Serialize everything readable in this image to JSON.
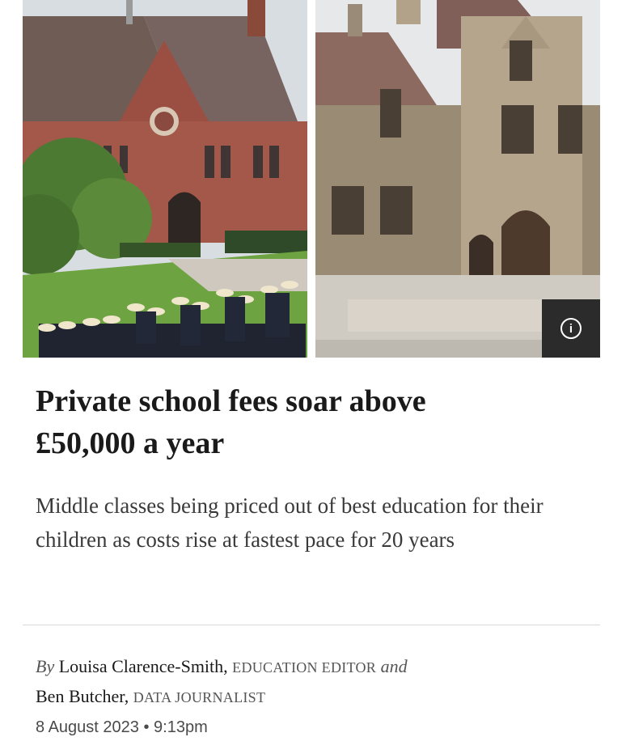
{
  "article": {
    "headline_line1": "Private school fees soar above",
    "headline_line2": "£50,000 a year",
    "standfirst": "Middle classes being priced out of best education for their children as costs rise at fastest pace for 20 years",
    "byline": {
      "by": "By",
      "author1": "Louisa Clarence-Smith,",
      "role1": "EDUCATION EDITOR",
      "and": "and",
      "author2": "Ben Butcher,",
      "role2": "DATA JOURNALIST"
    },
    "date": "8 August 2023",
    "separator": "•",
    "time": "9:13pm"
  },
  "media": {
    "info_icon": "info-icon",
    "info_glyph": "i"
  },
  "colors": {
    "text": "#1a1a1a",
    "muted": "#555555",
    "info_bg": "#2b2b2b",
    "divider": "#d9d9d9"
  }
}
